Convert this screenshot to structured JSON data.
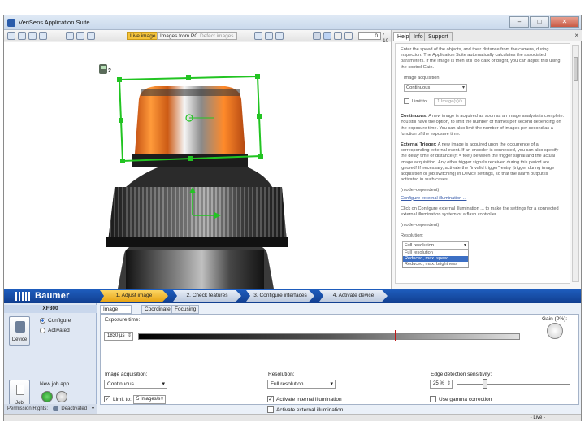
{
  "window": {
    "title": "VeriSens Application Suite",
    "min": "–",
    "max": "□",
    "close": "✕"
  },
  "toolbar": {
    "tab_live": "Live image",
    "tab_pc": "Images from PC",
    "tab_defect": "Defect images",
    "frame_value": "0",
    "frame_total": "/ 10"
  },
  "viewer": {
    "badge_count": "2"
  },
  "help_panel": {
    "tabs": [
      "Help",
      "Info",
      "Support"
    ],
    "close": "×",
    "intro": "Enter the speed of the objects, and their distance from the camera, during inspection. The Application Suite automatically calculates the associated parameters. If the image is then still too dark or bright, you can adjust this using the control Gain.",
    "acq_label": "Image acquisition:",
    "acq_value": "Continuous",
    "limit_label": "Limit to:",
    "limit_value": "1 Image(s)/s",
    "continuous_title": "Continuous:",
    "continuous_text": "A new image is acquired as soon as an image analysis is complete. You still have the option, to limit the number of frames per second depending on the exposure time. You can also limit the number of images per second as a function of the exposure time.",
    "trigger_title": "External Trigger:",
    "trigger_text": "A new image is acquired upon the occurrence of a corresponding external event. If an encoder is connected, you can also specify the delay time or distance (ft = feet) between the trigger signal and the actual image acquisition. Any other trigger signals received during this period are ignored! If necessary, activate the \"invalid trigger\" entry (trigger during image acquisition or job switching) in Device settings, so that the alarm output is activated in such cases.",
    "model_dep_1": "(model-dependent)",
    "config_link": "Configure external illumination ...",
    "click_text": "Click on Configure external illumination ... to make the settings for a connected external illumination system or a flash controller.",
    "model_dep_2": "(model-dependent)",
    "res_label": "Resolution:",
    "res_value": "Full resolution",
    "res_options": [
      "Full resolution",
      "Reduced, max. speed",
      "Reduced, max. brightness"
    ]
  },
  "workflow": {
    "brand": "Baumer",
    "steps": [
      "1. Adjust image",
      "2. Check features",
      "3. Configure interfaces",
      "4. Activate device"
    ]
  },
  "device_panel": {
    "device_name": "XF800",
    "device_btn": "Device",
    "configure": "Configure",
    "activated": "Activated",
    "job_file": "New job.app",
    "job_btn": "Job",
    "permission": "Permission Rights:",
    "permission_value": "Deactivated"
  },
  "settings": {
    "tabs": [
      "Image acquisition",
      "Coordinates",
      "Focusing"
    ],
    "exposure_label": "Exposure time:",
    "exposure_value": "1830 µs",
    "gain_label": "Gain (0%):",
    "acq_label": "Image acquisition:",
    "acq_value": "Continuous",
    "limit_label": "Limit to:",
    "limit_value": "5 Images/s",
    "res_label": "Resolution:",
    "res_value": "Full resolution",
    "internal_illum": "Activate internal illumination",
    "external_illum": "Activate external illumination",
    "edge_label": "Edge detection sensitivity:",
    "edge_value": "25 %",
    "gamma_label": "Use gamma correction"
  },
  "status": {
    "mode": "- Live -"
  },
  "colors": {
    "accent_blue": "#1f5fc0",
    "step_active": "#f5c33b",
    "roi_green": "#22c422",
    "ok_green": "#2aa52a"
  }
}
